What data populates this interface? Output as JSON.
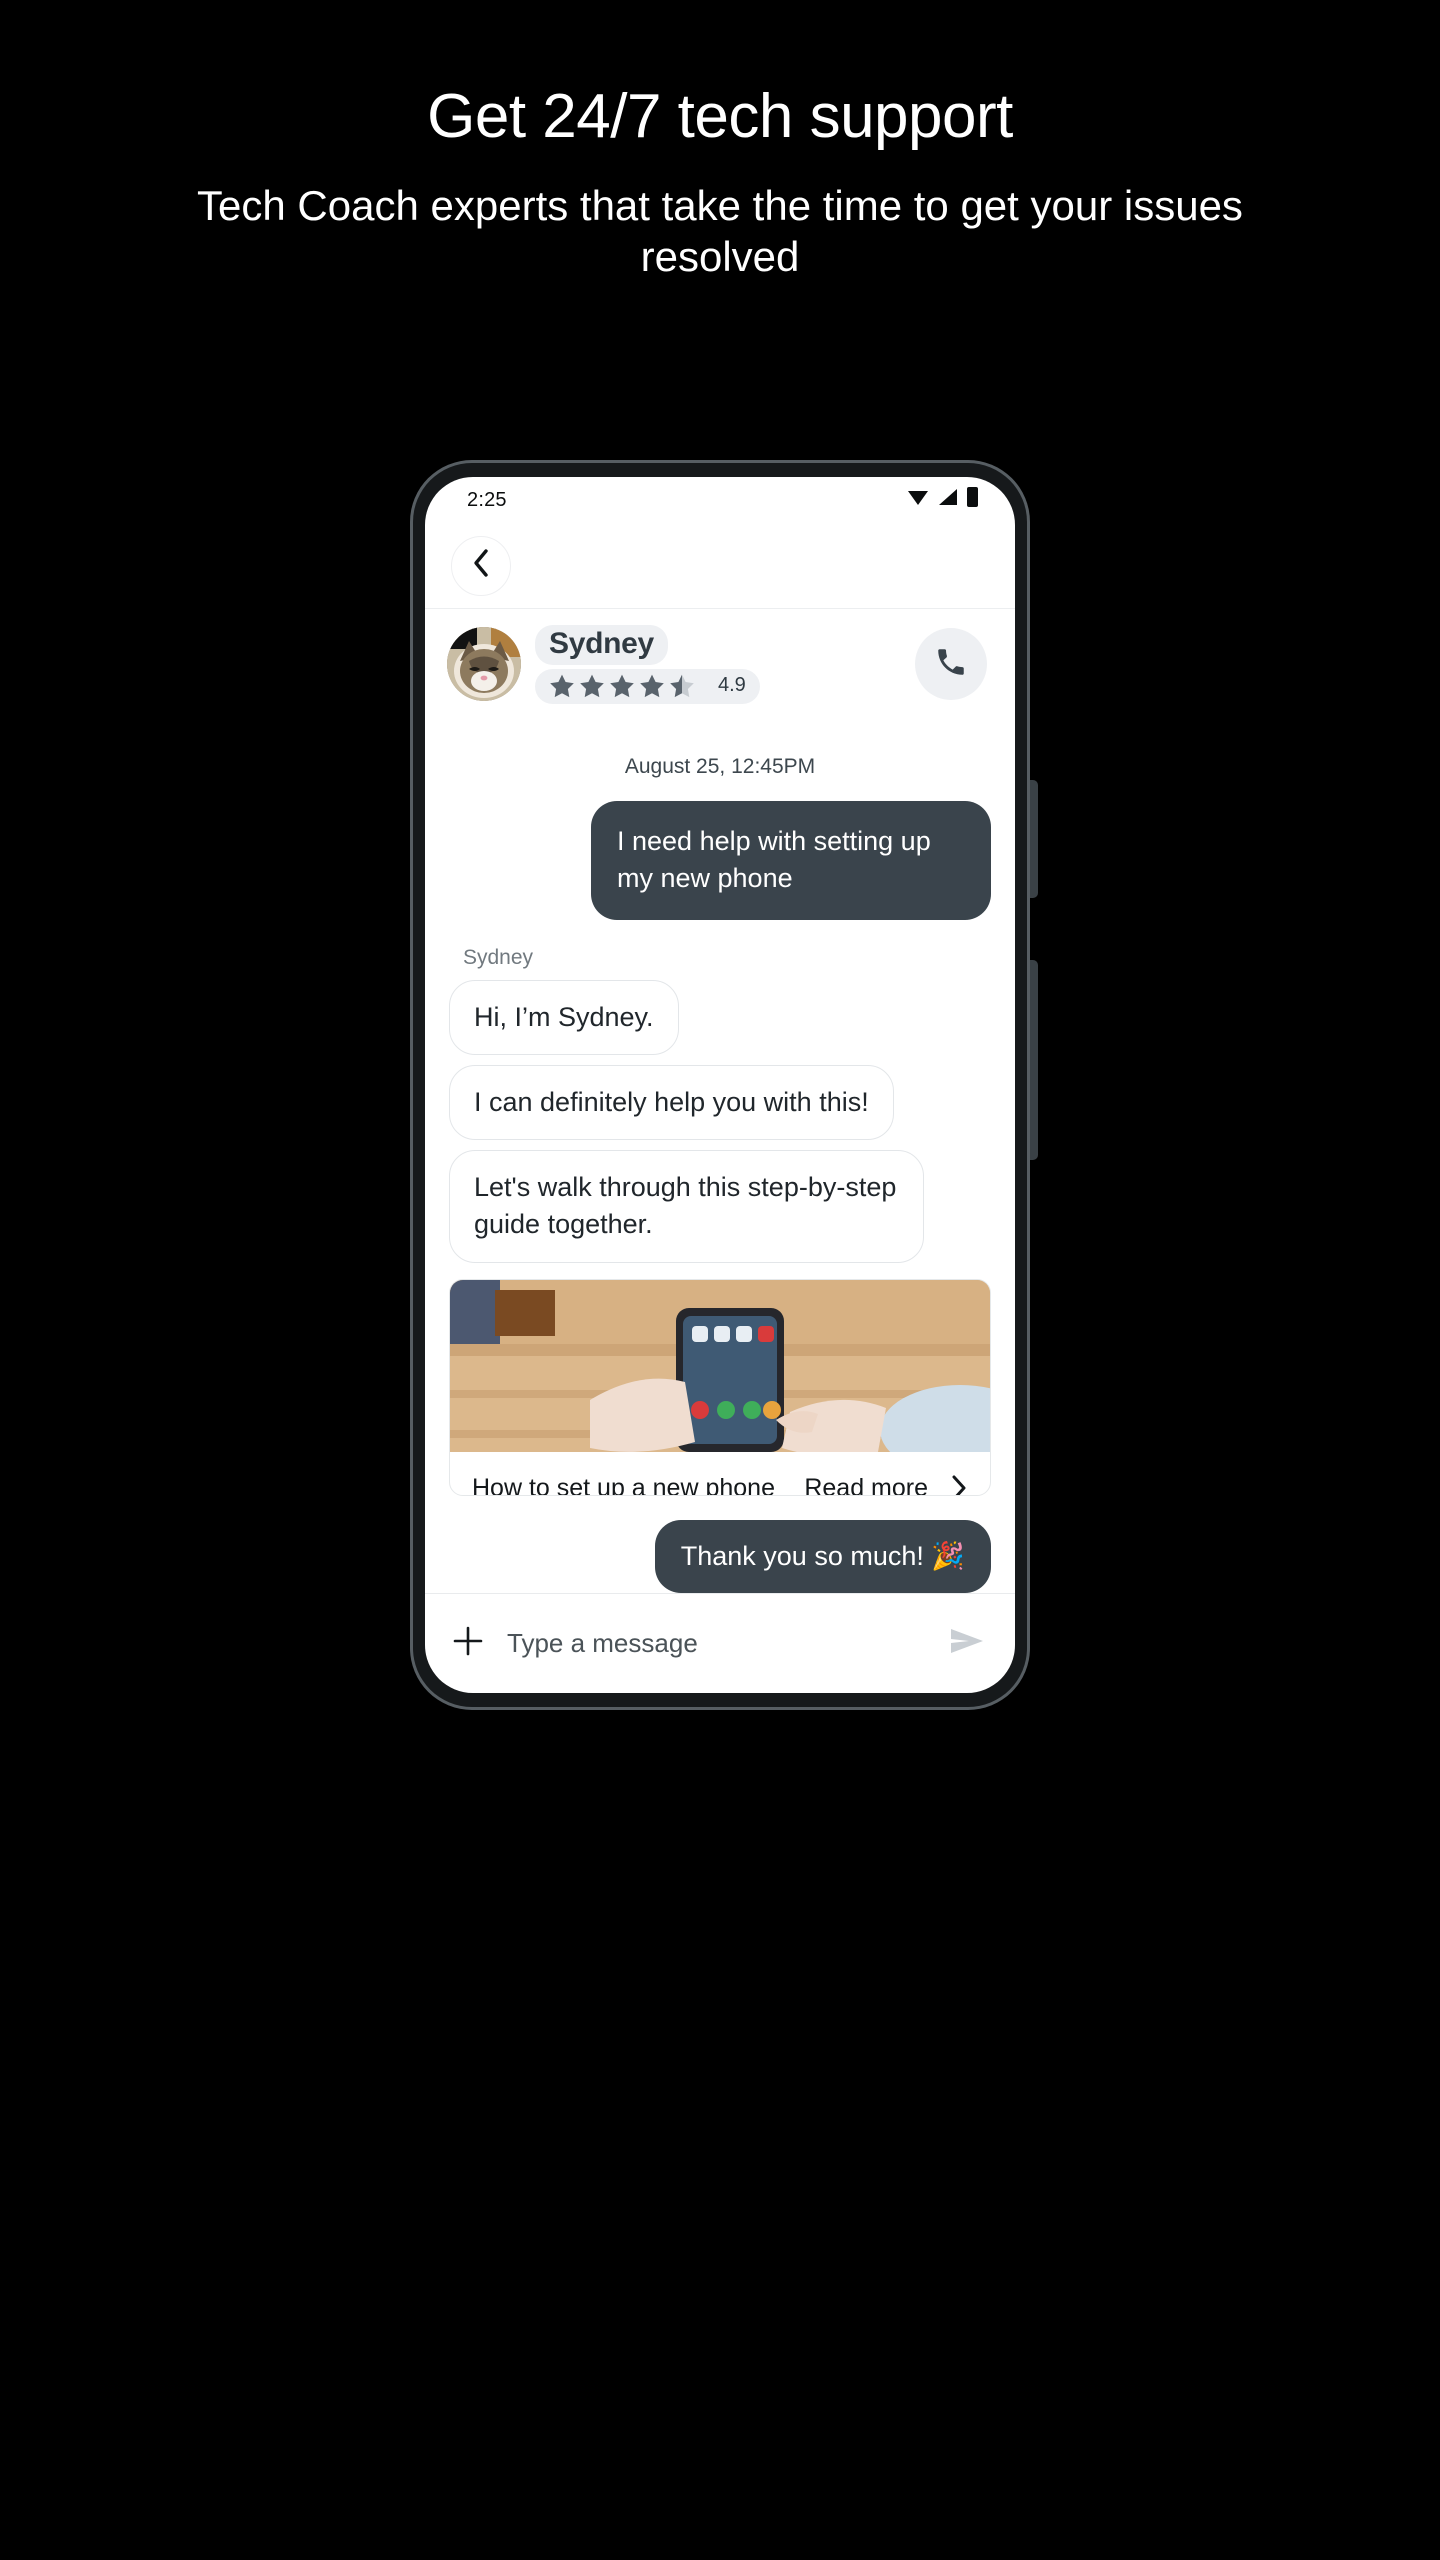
{
  "promo": {
    "title": "Get 24/7 tech support",
    "subtitle": "Tech Coach experts that take the time to get your issues resolved"
  },
  "phone": {
    "status": {
      "time": "2:25",
      "icons": [
        "wifi-icon",
        "signal-icon",
        "battery-icon"
      ]
    },
    "nav": {
      "back_icon": "chevron-left-icon"
    },
    "agent": {
      "avatar_alt": "cat-avatar",
      "name": "Sydney",
      "rating_value": "4.9",
      "stars": 4.5,
      "call_icon": "phone-icon"
    },
    "conversation": {
      "timestamp": "August 25, 12:45PM",
      "messages": [
        {
          "from": "user",
          "text": "I need help with setting up my new phone"
        },
        {
          "from": "agent",
          "sender": "Sydney",
          "text": "Hi, I’m Sydney."
        },
        {
          "from": "agent",
          "text": "I can definitely help you with this!"
        },
        {
          "from": "agent",
          "text": "Let's walk through this step-by-step guide together."
        }
      ],
      "article": {
        "title": "How to set up a new phone",
        "link_label": "Read more",
        "chevron_icon": "chevron-right-icon",
        "image_alt": "hands-holding-phone-on-desk"
      },
      "final_message": {
        "from": "user",
        "text": "Thank you so much! 🎉"
      }
    },
    "composer": {
      "add_icon": "plus-icon",
      "placeholder": "Type a message",
      "send_icon": "send-icon"
    }
  },
  "colors": {
    "background": "#000000",
    "bubble_out": "#3a444c",
    "pill": "#eef0f3",
    "star": "#59636c"
  }
}
